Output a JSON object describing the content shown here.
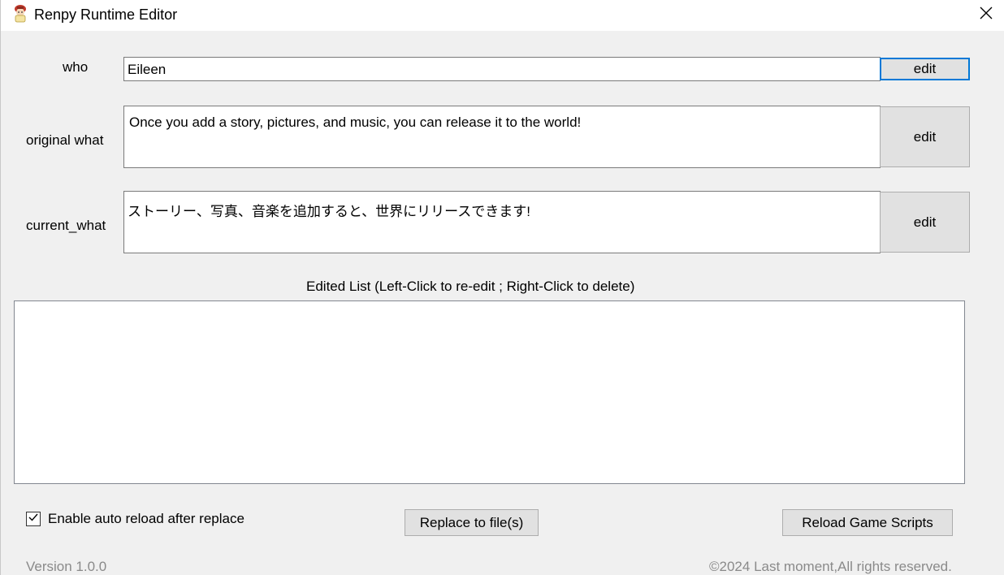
{
  "window": {
    "title": "Renpy Runtime Editor",
    "icon": "renpy-character-icon",
    "close_icon": "close-icon"
  },
  "fields": {
    "who": {
      "label": "who",
      "value": "Eileen",
      "button": "edit"
    },
    "original_what": {
      "label": "original what",
      "value": "Once you add a story, pictures, and music, you can release it to the world!",
      "button": "edit"
    },
    "current_what": {
      "label": "current_what",
      "value": "ストーリー、写真、音楽を追加すると、世界にリリースできます!",
      "button": "edit"
    }
  },
  "edited_list": {
    "heading": "Edited List (Left-Click to re-edit ; Right-Click to delete)",
    "items": []
  },
  "options": {
    "auto_reload_label": "Enable auto reload after replace",
    "auto_reload_checked": true
  },
  "actions": {
    "replace_label": "Replace to file(s)",
    "reload_label": "Reload Game Scripts"
  },
  "footer": {
    "version": "Version 1.0.0",
    "copyright": "©2024 Last moment,All rights reserved."
  },
  "colors": {
    "background": "#f0f0f0",
    "focus_border": "#0078d7",
    "button_face": "#e1e1e1",
    "footer_text": "#8a8a8a"
  }
}
